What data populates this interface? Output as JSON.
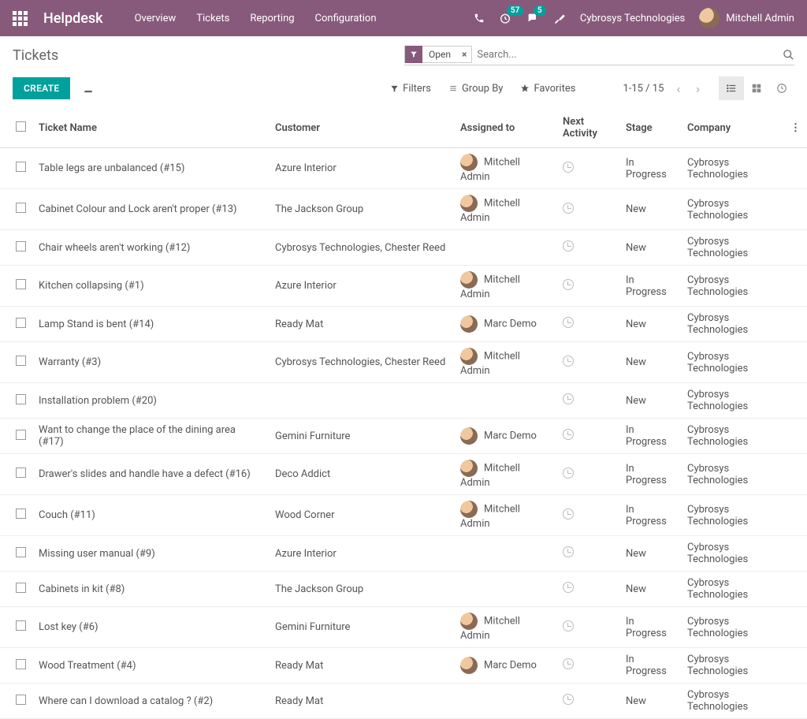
{
  "app_name": "Helpdesk",
  "nav": [
    "Overview",
    "Tickets",
    "Reporting",
    "Configuration"
  ],
  "badges": {
    "timer": "57",
    "chat": "5"
  },
  "company": "Cybrosys Technologies",
  "user": "Mitchell Admin",
  "breadcrumb": "Tickets",
  "search": {
    "facet_label": "Open",
    "placeholder": "Search..."
  },
  "buttons": {
    "create": "CREATE"
  },
  "options": {
    "filters": "Filters",
    "groupby": "Group By",
    "favorites": "Favorites"
  },
  "pager": "1-15 / 15",
  "columns": {
    "name": "Ticket Name",
    "customer": "Customer",
    "assigned": "Assigned to",
    "activity": "Next Activity",
    "stage": "Stage",
    "company": "Company"
  },
  "rows": [
    {
      "name": "Table legs are unbalanced (#15)",
      "customer": "Azure Interior",
      "assigned": "Mitchell Admin",
      "avatar": true,
      "stage": "In Progress",
      "company": "Cybrosys Technologies"
    },
    {
      "name": "Cabinet Colour and Lock aren't proper (#13)",
      "customer": "The Jackson Group",
      "assigned": "Mitchell Admin",
      "avatar": true,
      "stage": "New",
      "company": "Cybrosys Technologies"
    },
    {
      "name": "Chair wheels aren't working (#12)",
      "customer": "Cybrosys Technologies, Chester Reed",
      "assigned": "",
      "avatar": false,
      "stage": "New",
      "company": "Cybrosys Technologies"
    },
    {
      "name": "Kitchen collapsing (#1)",
      "customer": "Azure Interior",
      "assigned": "Mitchell Admin",
      "avatar": true,
      "stage": "In Progress",
      "company": "Cybrosys Technologies"
    },
    {
      "name": "Lamp Stand is bent (#14)",
      "customer": "Ready Mat",
      "assigned": "Marc Demo",
      "avatar": true,
      "stage": "New",
      "company": "Cybrosys Technologies"
    },
    {
      "name": "Warranty (#3)",
      "customer": "Cybrosys Technologies, Chester Reed",
      "assigned": "Mitchell Admin",
      "avatar": true,
      "stage": "New",
      "company": "Cybrosys Technologies"
    },
    {
      "name": "Installation problem (#20)",
      "customer": "",
      "assigned": "",
      "avatar": false,
      "stage": "New",
      "company": "Cybrosys Technologies"
    },
    {
      "name": "Want to change the place of the dining area (#17)",
      "customer": "Gemini Furniture",
      "assigned": "Marc Demo",
      "avatar": true,
      "stage": "In Progress",
      "company": "Cybrosys Technologies"
    },
    {
      "name": "Drawer's slides and handle have a defect (#16)",
      "customer": "Deco Addict",
      "assigned": "Mitchell Admin",
      "avatar": true,
      "stage": "In Progress",
      "company": "Cybrosys Technologies"
    },
    {
      "name": "Couch (#11)",
      "customer": "Wood Corner",
      "assigned": "Mitchell Admin",
      "avatar": true,
      "stage": "In Progress",
      "company": "Cybrosys Technologies"
    },
    {
      "name": "Missing user manual (#9)",
      "customer": "Azure Interior",
      "assigned": "",
      "avatar": false,
      "stage": "New",
      "company": "Cybrosys Technologies"
    },
    {
      "name": "Cabinets in kit (#8)",
      "customer": "The Jackson Group",
      "assigned": "",
      "avatar": false,
      "stage": "New",
      "company": "Cybrosys Technologies"
    },
    {
      "name": "Lost key (#6)",
      "customer": "Gemini Furniture",
      "assigned": "Mitchell Admin",
      "avatar": true,
      "stage": "In Progress",
      "company": "Cybrosys Technologies"
    },
    {
      "name": "Wood Treatment (#4)",
      "customer": "Ready Mat",
      "assigned": "Marc Demo",
      "avatar": true,
      "stage": "In Progress",
      "company": "Cybrosys Technologies"
    },
    {
      "name": "Where can I download a catalog ? (#2)",
      "customer": "Ready Mat",
      "assigned": "",
      "avatar": false,
      "stage": "New",
      "company": "Cybrosys Technologies"
    }
  ]
}
